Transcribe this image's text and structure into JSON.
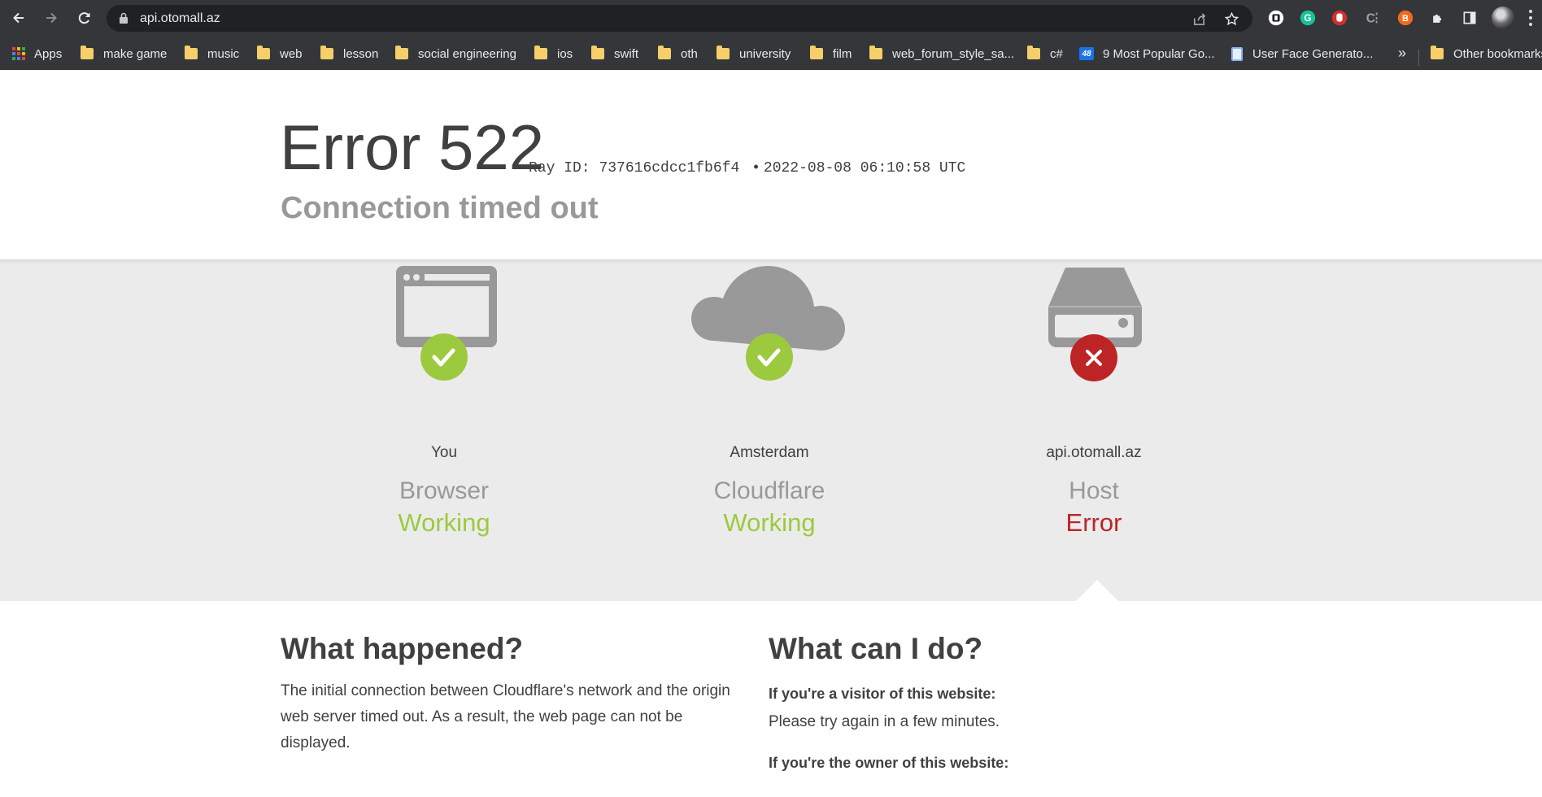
{
  "browser": {
    "url": "api.otomall.az",
    "bookmarks": [
      {
        "label": "Apps",
        "kind": "apps"
      },
      {
        "label": "make game",
        "kind": "folder"
      },
      {
        "label": "music",
        "kind": "folder"
      },
      {
        "label": "web",
        "kind": "folder"
      },
      {
        "label": "lesson",
        "kind": "folder"
      },
      {
        "label": "social engineering",
        "kind": "folder"
      },
      {
        "label": "ios",
        "kind": "folder"
      },
      {
        "label": "swift",
        "kind": "folder"
      },
      {
        "label": "oth",
        "kind": "folder"
      },
      {
        "label": "university",
        "kind": "folder"
      },
      {
        "label": "film",
        "kind": "folder"
      },
      {
        "label": "web_forum_style_sa...",
        "kind": "folder"
      },
      {
        "label": "c#",
        "kind": "folder"
      },
      {
        "label": "9 Most Popular Go...",
        "kind": "site-48"
      },
      {
        "label": "User Face Generato...",
        "kind": "site-page"
      }
    ],
    "more_label": "»",
    "other_bookmarks": "Other bookmarks"
  },
  "page": {
    "title": "Error 522",
    "ray_label": "Ray ID:",
    "ray_id": "737616cdcc1fb6f4",
    "separator": "•",
    "timestamp": "2022-08-08 06:10:58 UTC",
    "subtitle": "Connection timed out",
    "nodes": [
      {
        "where": "You",
        "kind": "Browser",
        "state": "Working",
        "icon": "browser-icon"
      },
      {
        "where": "Amsterdam",
        "kind": "Cloudflare",
        "state": "Working",
        "icon": "cloud-icon"
      },
      {
        "where": "api.otomall.az",
        "kind": "Host",
        "state": "Error",
        "icon": "server-icon"
      }
    ],
    "what_happened": {
      "heading": "What happened?",
      "body": "The initial connection between Cloudflare's network and the origin web server timed out. As a result, the web page can not be displayed."
    },
    "what_can_i_do": {
      "heading": "What can I do?",
      "visitor_heading": "If you're a visitor of this website:",
      "visitor_body": "Please try again in a few minutes.",
      "owner_heading": "If you're the owner of this website:"
    }
  },
  "colors": {
    "working": "#9bca3e",
    "error": "#bd2426",
    "band": "#ebebeb",
    "chrome": "#35363a"
  }
}
